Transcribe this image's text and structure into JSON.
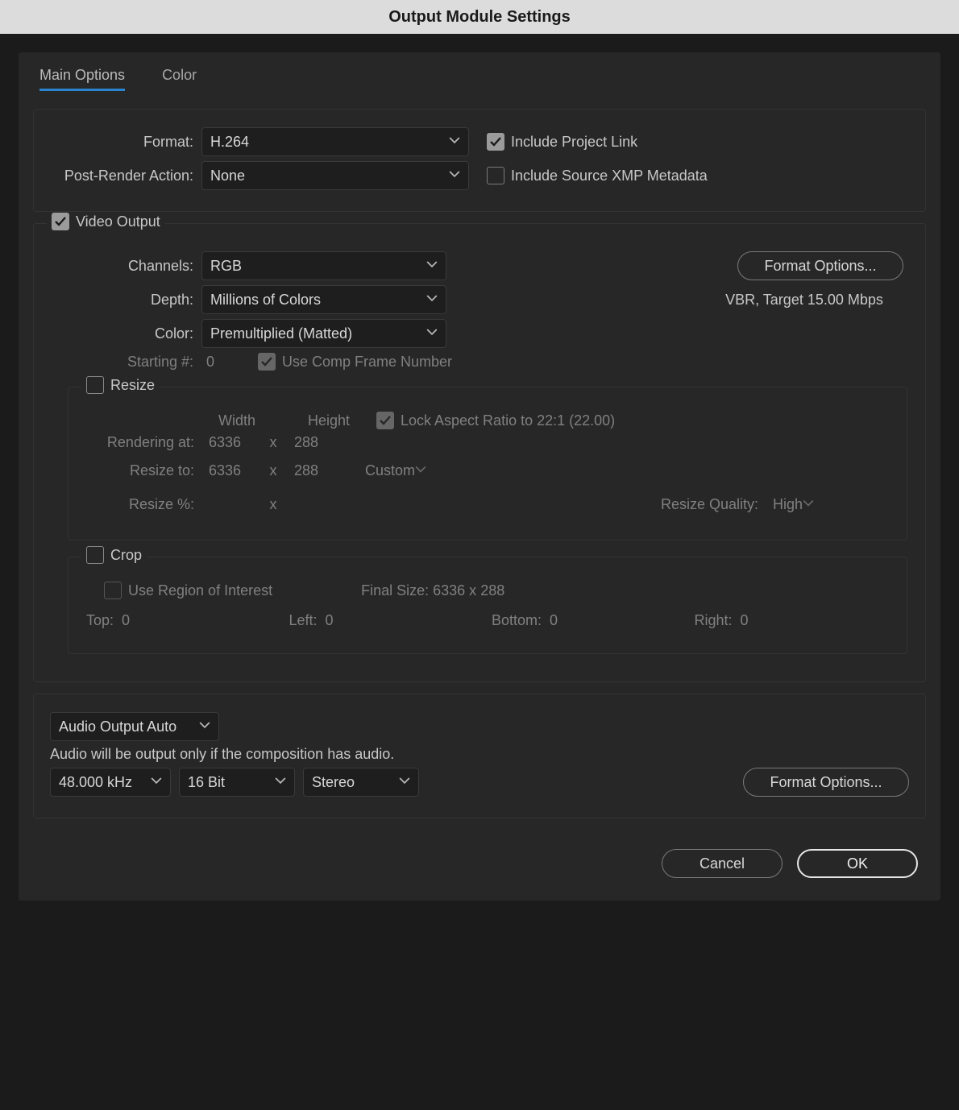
{
  "title": "Output Module Settings",
  "tabs": {
    "main": "Main Options",
    "color": "Color"
  },
  "format": {
    "label": "Format:",
    "value": "H.264"
  },
  "postRender": {
    "label": "Post-Render Action:",
    "value": "None"
  },
  "includeProjectLink": "Include Project Link",
  "includeXMP": "Include Source XMP Metadata",
  "videoOutput": "Video Output",
  "channels": {
    "label": "Channels:",
    "value": "RGB"
  },
  "depth": {
    "label": "Depth:",
    "value": "Millions of Colors"
  },
  "colorMode": {
    "label": "Color:",
    "value": "Premultiplied (Matted)"
  },
  "formatOptions": "Format Options...",
  "formatStatus": "VBR, Target 15.00 Mbps",
  "startingNum": {
    "label": "Starting #:",
    "value": "0"
  },
  "useCompFrame": "Use Comp Frame Number",
  "resize": {
    "title": "Resize",
    "widthLbl": "Width",
    "heightLbl": "Height",
    "lockAspect": "Lock Aspect Ratio to 22:1 (22.00)",
    "renderingAtLbl": "Rendering at:",
    "renderingW": "6336",
    "renderingH": "288",
    "resizeToLbl": "Resize to:",
    "resizeW": "6336",
    "resizeH": "288",
    "preset": "Custom",
    "resizePctLbl": "Resize %:",
    "qualityLbl": "Resize Quality:",
    "quality": "High",
    "x": "x"
  },
  "crop": {
    "title": "Crop",
    "roi": "Use Region of Interest",
    "finalSize": "Final Size: 6336 x 288",
    "topLbl": "Top:",
    "top": "0",
    "leftLbl": "Left:",
    "left": "0",
    "bottomLbl": "Bottom:",
    "bottom": "0",
    "rightLbl": "Right:",
    "right": "0"
  },
  "audio": {
    "mode": "Audio Output Auto",
    "note": "Audio will be output only if the composition has audio.",
    "rate": "48.000 kHz",
    "depth": "16 Bit",
    "channels": "Stereo",
    "formatOptions": "Format Options..."
  },
  "buttons": {
    "cancel": "Cancel",
    "ok": "OK"
  }
}
